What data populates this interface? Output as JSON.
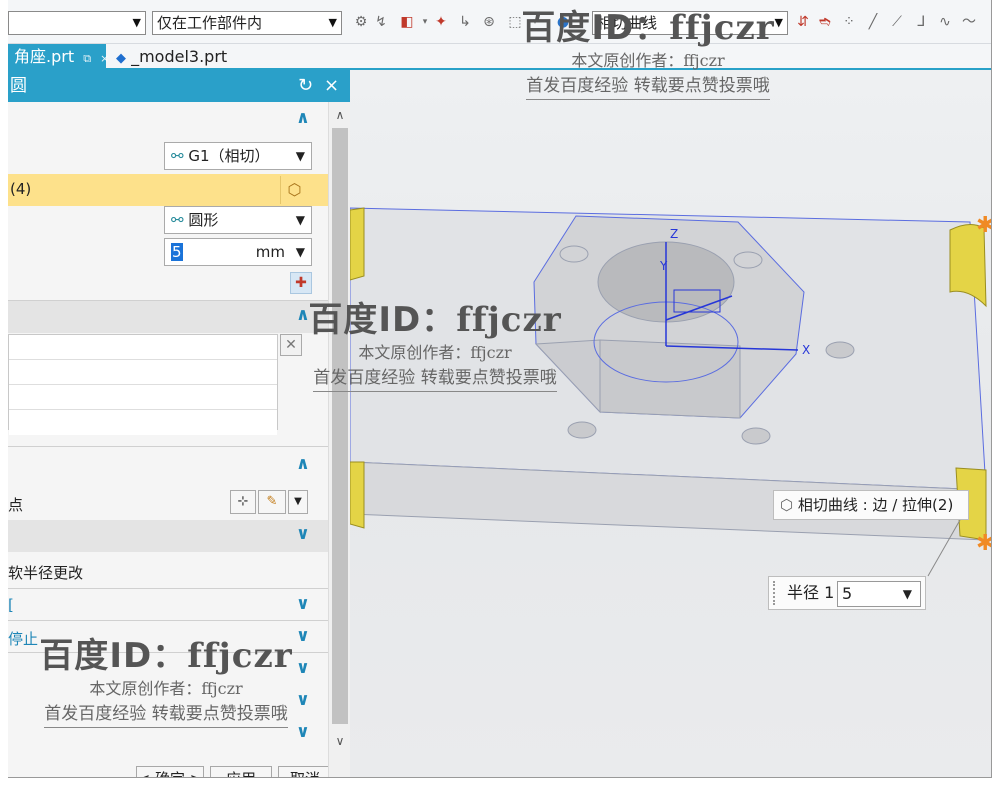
{
  "toolbar": {
    "left_combo_value": "",
    "scope_combo_value": "仅在工作部件内",
    "curve_combo_value": "相切曲线",
    "icons": [
      "snap-icon",
      "snap2-icon",
      "select-box-icon",
      "point-icon",
      "point2-icon",
      "point3-icon",
      "box-select-icon",
      "sphere-icon",
      "arrow-red-icon",
      "diamond-icon",
      "dots-icon",
      "line-icon",
      "line2-icon",
      "hook-icon",
      "curve-icon",
      "wave-icon"
    ]
  },
  "tabs": [
    {
      "label": "角座.prt",
      "active": true
    },
    {
      "label": "_model3.prt",
      "active": false
    }
  ],
  "dialog": {
    "title": "圆",
    "reset_symbol": "↻",
    "close_symbol": "×",
    "continuity_value": "G1（相切）",
    "edge_label": "(4)",
    "shape_value": "圆形",
    "radius_value": "5",
    "radius_unit": "mm",
    "point_label": "点",
    "soft_radius_label": "软半径更改",
    "section_stop_label": "停止",
    "confirm_label": "< 确定 >",
    "apply_label": "应用",
    "cancel_label": "取消"
  },
  "viewport": {
    "tooltip_text": "相切曲线 : 边 / 拉伸(2)",
    "radius_label": "半径 1",
    "radius_value": "5",
    "axis_x": "X",
    "axis_y": "Y",
    "axis_z": "Z"
  },
  "watermark": {
    "title_prefix": "百度",
    "title_id": "ID：",
    "title_user": "ffjczr",
    "line1": "本文原创作者：ffjczr",
    "line2": "首发百度经验 转载要点赞投票哦"
  }
}
